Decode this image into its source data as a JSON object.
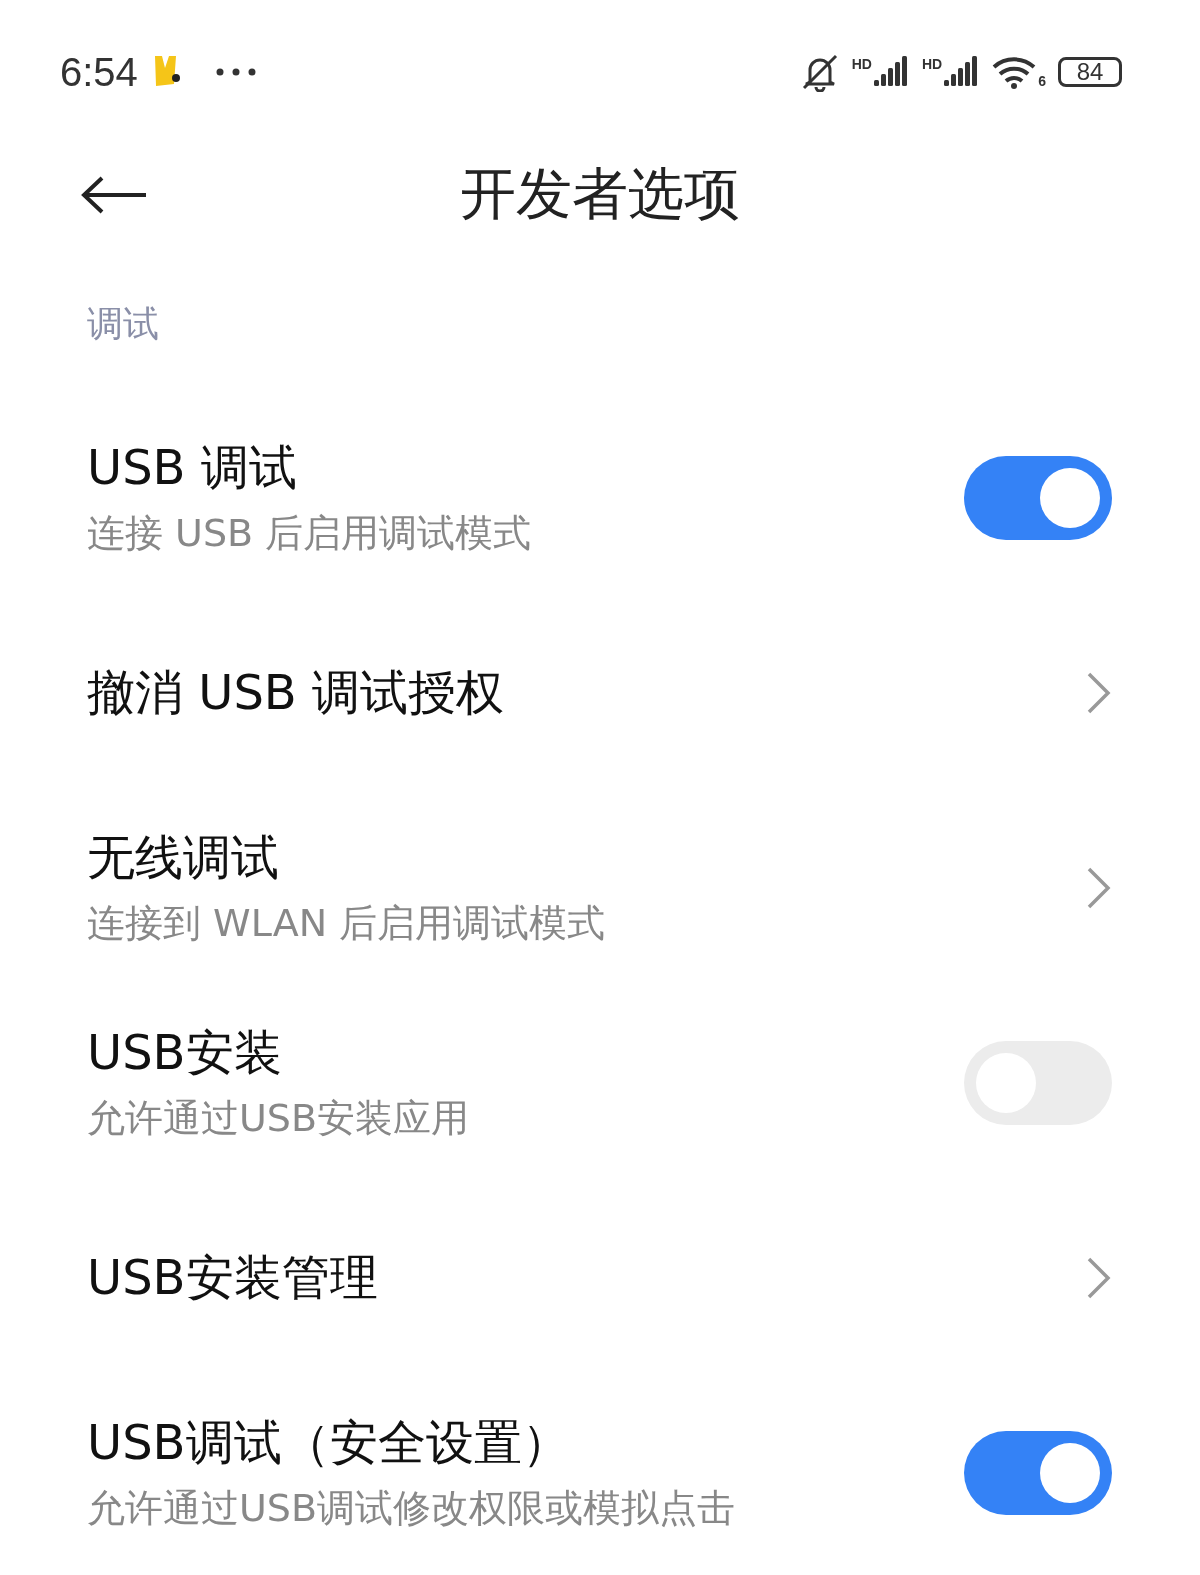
{
  "status_bar": {
    "time": "6:54",
    "signal_1_label": "HD",
    "signal_2_label": "HD",
    "wifi_label": "6",
    "battery": "84"
  },
  "header": {
    "title": "开发者选项"
  },
  "section": {
    "title": "调试"
  },
  "items": [
    {
      "kind": "toggle",
      "title": "USB 调试",
      "subtitle": "连接 USB 后启用调试模式",
      "on": true
    },
    {
      "kind": "link",
      "title": "撤消 USB 调试授权"
    },
    {
      "kind": "link",
      "title": "无线调试",
      "subtitle": "连接到 WLAN 后启用调试模式"
    },
    {
      "kind": "toggle",
      "title": "USB安装",
      "subtitle": "允许通过USB安装应用",
      "on": false
    },
    {
      "kind": "link",
      "title": "USB安装管理"
    },
    {
      "kind": "toggle",
      "title": "USB调试（安全设置）",
      "subtitle": "允许通过USB调试修改权限或模拟点击",
      "on": true
    }
  ]
}
